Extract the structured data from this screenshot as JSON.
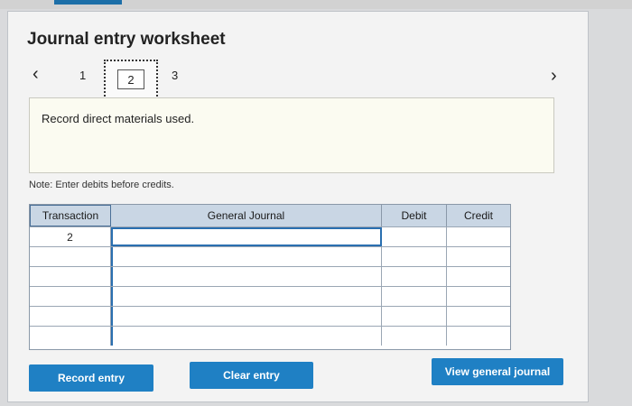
{
  "worksheet": {
    "title": "Journal entry worksheet",
    "nav": {
      "prev_icon": "chevron-left-icon",
      "next_icon": "chevron-right-icon"
    },
    "steps": [
      "1",
      "2",
      "3"
    ],
    "active_step": "2",
    "instruction": "Record direct materials used.",
    "note": "Note: Enter debits before credits."
  },
  "journal_table": {
    "headers": [
      "Transaction",
      "General Journal",
      "Debit",
      "Credit"
    ],
    "rows": [
      {
        "transaction": "2",
        "account": "",
        "debit": "",
        "credit": ""
      },
      {
        "transaction": "",
        "account": "",
        "debit": "",
        "credit": ""
      },
      {
        "transaction": "",
        "account": "",
        "debit": "",
        "credit": ""
      },
      {
        "transaction": "",
        "account": "",
        "debit": "",
        "credit": ""
      },
      {
        "transaction": "",
        "account": "",
        "debit": "",
        "credit": ""
      },
      {
        "transaction": "",
        "account": "",
        "debit": "",
        "credit": ""
      }
    ]
  },
  "buttons": {
    "record": "Record entry",
    "clear": "Clear entry",
    "view": "View general journal"
  },
  "colors": {
    "accent": "#1f80c4",
    "header_bg": "#c9d6e4",
    "instruction_bg": "#fbfbf1"
  }
}
